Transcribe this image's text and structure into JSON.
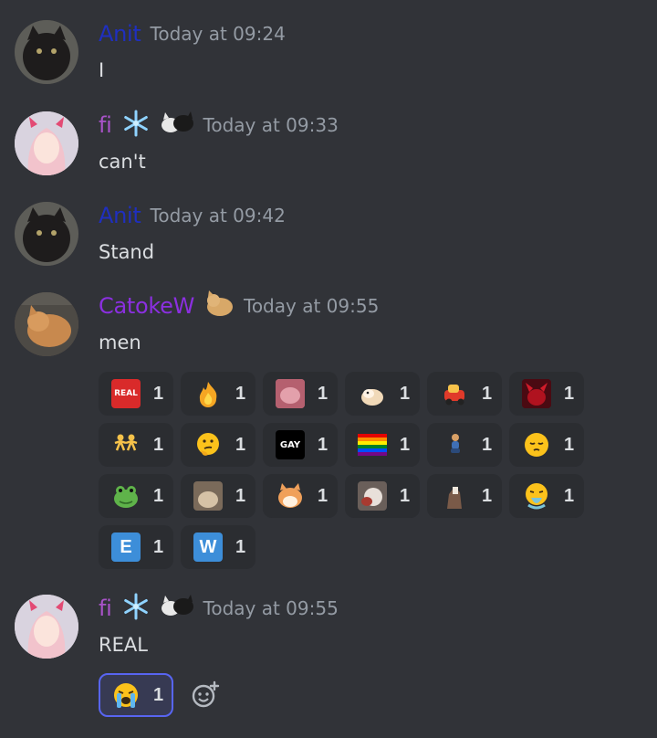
{
  "messages": [
    {
      "author": "Anit",
      "author_color": "#1f2fbf",
      "timestamp": "Today at 09:24",
      "text": "I"
    },
    {
      "author": "fi",
      "author_color": "#a953c9",
      "timestamp": "Today at 09:33",
      "text": "can't"
    },
    {
      "author": "Anit",
      "author_color": "#1f2fbf",
      "timestamp": "Today at 09:42",
      "text": "Stand"
    },
    {
      "author": "CatokeW",
      "author_color": "#8b2fe0",
      "timestamp": "Today at 09:55",
      "text": "men"
    },
    {
      "author": "fi",
      "author_color": "#a953c9",
      "timestamp": "Today at 09:55",
      "text": "REAL"
    }
  ],
  "reactions_men": [
    {
      "emoji": "real-emoji",
      "label": "REAL",
      "count": "1"
    },
    {
      "emoji": "fire-emoji",
      "count": "1"
    },
    {
      "emoji": "pink-cat-emoji",
      "count": "1"
    },
    {
      "emoji": "hamster-emoji",
      "count": "1"
    },
    {
      "emoji": "toy-car-emoji",
      "count": "1"
    },
    {
      "emoji": "red-demon-emoji",
      "count": "1"
    },
    {
      "emoji": "dancing-men-emoji",
      "count": "1"
    },
    {
      "emoji": "thinking-face-emoji",
      "count": "1"
    },
    {
      "emoji": "gay-emoji",
      "label": "GAY",
      "count": "1"
    },
    {
      "emoji": "rainbow-flag-emoji",
      "count": "1"
    },
    {
      "emoji": "person-kneeling-emoji",
      "count": "1"
    },
    {
      "emoji": "pensive-face-emoji",
      "count": "1"
    },
    {
      "emoji": "frog-emoji",
      "count": "1"
    },
    {
      "emoji": "cat-photo-emoji",
      "count": "1"
    },
    {
      "emoji": "shiba-emoji",
      "count": "1"
    },
    {
      "emoji": "cat-photo-2-emoji",
      "count": "1"
    },
    {
      "emoji": "horse-emoji",
      "count": "1"
    },
    {
      "emoji": "vomiting-face-emoji",
      "count": "1"
    },
    {
      "emoji": "letter-e-emoji",
      "label": "E",
      "count": "1"
    },
    {
      "emoji": "letter-w-emoji",
      "label": "W",
      "count": "1"
    }
  ],
  "reactions_real": [
    {
      "emoji": "loudly-crying-face-emoji",
      "count": "1"
    }
  ],
  "colors": {
    "background": "#313338",
    "reaction_bg": "#2b2d31",
    "accent": "#5865f2",
    "timestamp": "#949ba4"
  }
}
